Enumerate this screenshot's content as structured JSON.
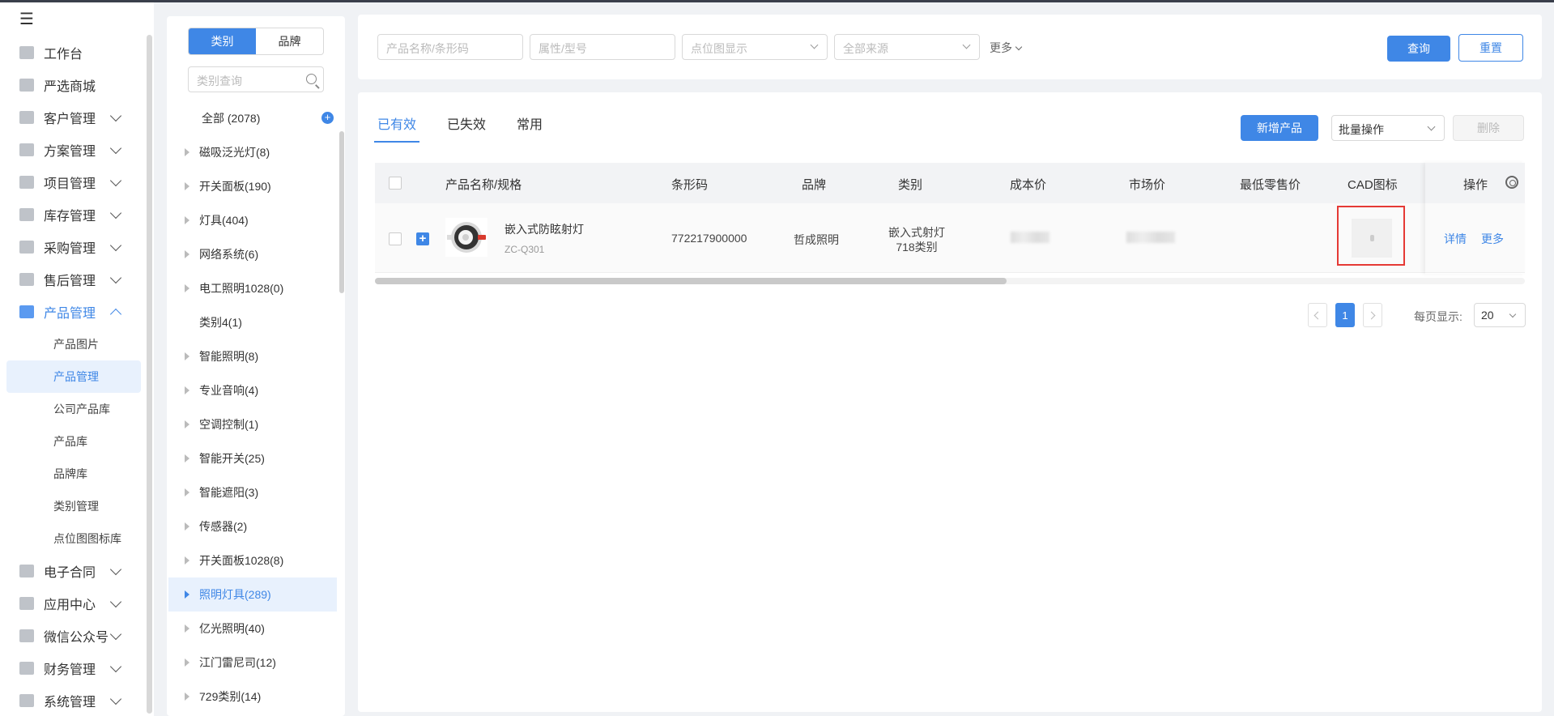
{
  "sidebar": {
    "items": [
      {
        "label": "工作台",
        "icon": "home-icon",
        "chevron": false
      },
      {
        "label": "严选商城",
        "icon": "store-icon",
        "chevron": false
      },
      {
        "label": "客户管理",
        "icon": "customer-icon",
        "chevron": true
      },
      {
        "label": "方案管理",
        "icon": "plan-icon",
        "chevron": true
      },
      {
        "label": "项目管理",
        "icon": "folder-icon",
        "chevron": true
      },
      {
        "label": "库存管理",
        "icon": "inventory-icon",
        "chevron": true
      },
      {
        "label": "采购管理",
        "icon": "cart-icon",
        "chevron": true
      },
      {
        "label": "售后管理",
        "icon": "headset-icon",
        "chevron": true
      },
      {
        "label": "产品管理",
        "icon": "box-icon",
        "chevron": true,
        "active": true
      }
    ],
    "sub_items": [
      "产品图片",
      "产品管理",
      "公司产品库",
      "产品库",
      "品牌库",
      "类别管理",
      "点位图图标库"
    ],
    "active_sub": "产品管理",
    "bottom_items": [
      {
        "label": "电子合同",
        "icon": "contract-icon"
      },
      {
        "label": "应用中心",
        "icon": "apps-icon"
      },
      {
        "label": "微信公众号",
        "icon": "wechat-icon"
      },
      {
        "label": "财务管理",
        "icon": "finance-icon"
      },
      {
        "label": "系统管理",
        "icon": "settings-icon"
      }
    ]
  },
  "category_panel": {
    "tabs": [
      "类别",
      "品牌"
    ],
    "active_tab": "类别",
    "search_placeholder": "类别查询",
    "all_label": "全部 (2078)",
    "items": [
      {
        "label": "磁吸泛光灯(8)",
        "expandable": true
      },
      {
        "label": "开关面板(190)",
        "expandable": true
      },
      {
        "label": "灯具(404)",
        "expandable": true
      },
      {
        "label": "网络系统(6)",
        "expandable": true
      },
      {
        "label": "电工照明1028(0)",
        "expandable": true
      },
      {
        "label": "类别4(1)",
        "expandable": false
      },
      {
        "label": "智能照明(8)",
        "expandable": true
      },
      {
        "label": "专业音响(4)",
        "expandable": true
      },
      {
        "label": "空调控制(1)",
        "expandable": true
      },
      {
        "label": "智能开关(25)",
        "expandable": true
      },
      {
        "label": "智能遮阳(3)",
        "expandable": true
      },
      {
        "label": "传感器(2)",
        "expandable": true
      },
      {
        "label": "开关面板1028(8)",
        "expandable": true
      },
      {
        "label": "照明灯具(289)",
        "expandable": true,
        "active": true
      },
      {
        "label": "亿光照明(40)",
        "expandable": true
      },
      {
        "label": "江门雷尼司(12)",
        "expandable": true
      },
      {
        "label": "729类别(14)",
        "expandable": true
      }
    ]
  },
  "filter": {
    "name_placeholder": "产品名称/条形码",
    "attr_placeholder": "属性/型号",
    "point_placeholder": "点位图显示",
    "source_placeholder": "全部来源",
    "more_label": "更多",
    "query_label": "查询",
    "reset_label": "重置"
  },
  "main": {
    "tabs": [
      "已有效",
      "已失效",
      "常用"
    ],
    "active_tab": "已有效",
    "add_label": "新增产品",
    "batch_label": "批量操作",
    "delete_label": "删除",
    "columns": {
      "name": "产品名称/规格",
      "barcode": "条形码",
      "brand": "品牌",
      "category": "类别",
      "cost": "成本价",
      "market": "市场价",
      "min_retail": "最低零售价",
      "cad": "CAD图标",
      "ops": "操作"
    },
    "rows": [
      {
        "name": "嵌入式防眩射灯",
        "spec": "ZC-Q301",
        "barcode": "772217900000",
        "brand": "哲成照明",
        "category_line1": "嵌入式射灯",
        "category_line2": "718类别",
        "detail_label": "详情",
        "more_label": "更多"
      }
    ]
  },
  "pagination": {
    "current": "1",
    "per_page_label": "每页显示:",
    "per_page": "20"
  },
  "colors": {
    "accent": "#3f87e6",
    "highlight": "#e53935"
  }
}
